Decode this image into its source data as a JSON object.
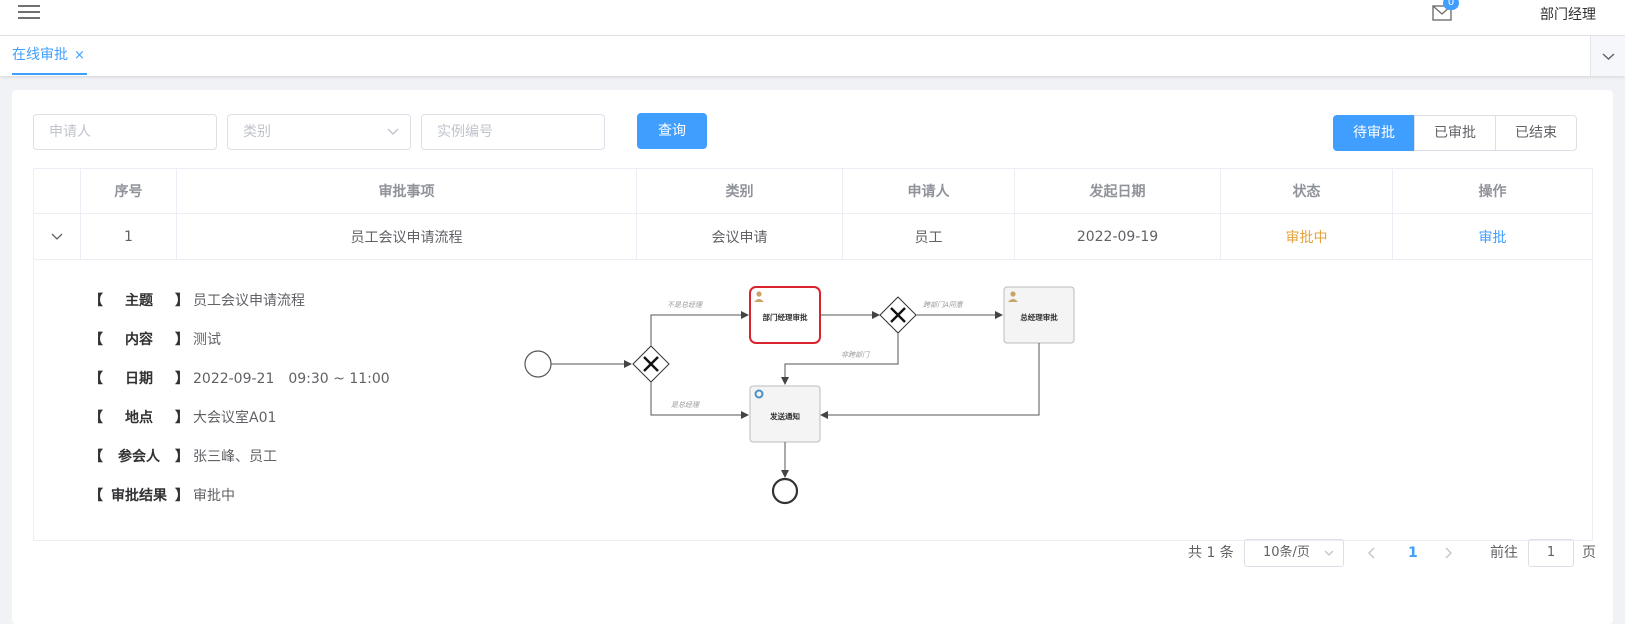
{
  "header": {
    "mail_count": "0",
    "username": "部门经理"
  },
  "tabs": [
    {
      "label": "在线审批",
      "close": "×"
    }
  ],
  "filters": {
    "applicant_placeholder": "申请人",
    "category_placeholder": "类别",
    "instance_placeholder": "实例编号",
    "query_label": "查询"
  },
  "status_tabs": [
    "待审批",
    "已审批",
    "已结束"
  ],
  "table": {
    "columns": [
      "序号",
      "审批事项",
      "类别",
      "申请人",
      "发起日期",
      "状态",
      "操作"
    ],
    "rows": [
      {
        "index": "1",
        "item": "员工会议申请流程",
        "category": "会议申请",
        "applicant": "员工",
        "date": "2022-09-19",
        "status": "审批中",
        "action": "审批"
      }
    ]
  },
  "detail": [
    {
      "key": "主题",
      "value": "员工会议申请流程"
    },
    {
      "key": "内容",
      "value": "测试"
    },
    {
      "key": "日期",
      "value": "2022-09-21　09:30 ~ 11:00"
    },
    {
      "key": "地点",
      "value": "大会议室A01"
    },
    {
      "key": "参会人",
      "value": "张三峰、员工"
    },
    {
      "key": "审批结果",
      "value": "审批中"
    }
  ],
  "workflow": {
    "task_dept": "部门经理审批",
    "task_gm": "总经理审批",
    "task_notify": "发送通知",
    "flow_not_gm": "不是总经理",
    "flow_is_gm": "是总经理",
    "flow_cross_dept": "跨部门A同意",
    "flow_non_cross": "非跨部门"
  },
  "pagination": {
    "total": "共 1 条",
    "page_size": "10条/页",
    "current": "1",
    "goto_label": "前往",
    "goto_value": "1",
    "page_unit": "页"
  },
  "colors": {
    "primary": "#409eff",
    "status_pending": "#e6a23c",
    "active_task": "#d9232d"
  }
}
